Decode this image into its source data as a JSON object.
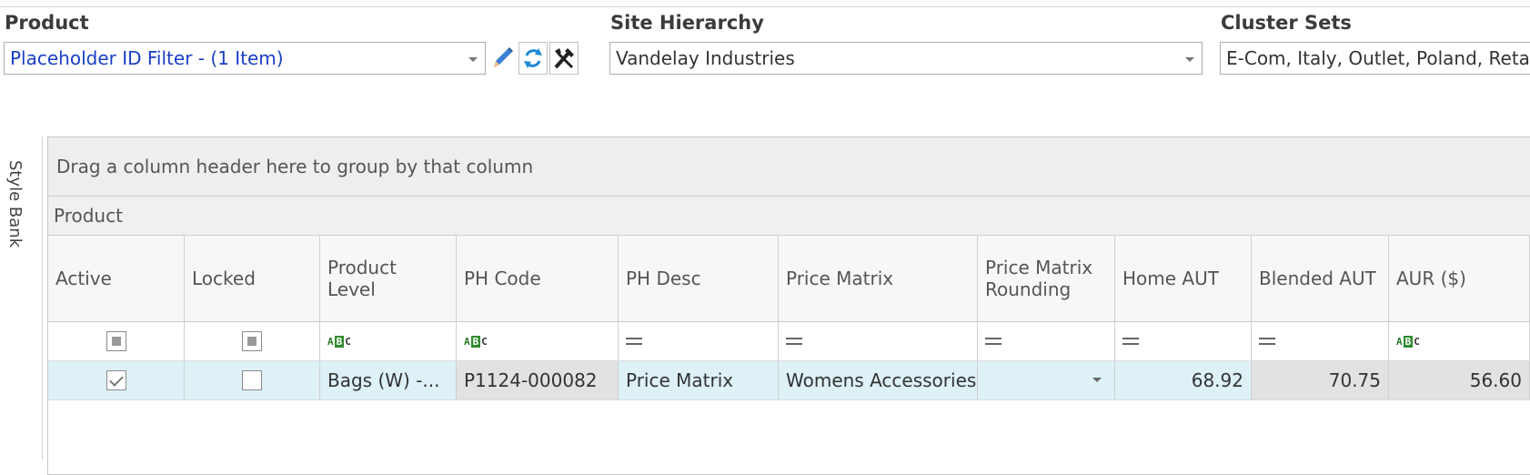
{
  "filters": {
    "product": {
      "label": "Product",
      "value": "Placeholder ID Filter - (1 Item)"
    },
    "site_hierarchy": {
      "label": "Site Hierarchy",
      "value": "Vandelay Industries"
    },
    "cluster_sets": {
      "label": "Cluster Sets",
      "value": "E-Com, Italy, Outlet, Poland, Retai"
    }
  },
  "toolbar_icons": [
    "pencil-icon",
    "refresh-icon",
    "tools-icon"
  ],
  "sidebar": {
    "label": "Style Bank"
  },
  "grid": {
    "group_hint": "Drag a column header here to group by that column",
    "band": "Product",
    "columns": {
      "active": "Active",
      "locked": "Locked",
      "product_level": "Product Level",
      "ph_code": "PH Code",
      "ph_desc": "PH Desc",
      "price_matrix": "Price Matrix",
      "price_matrix_rounding": "Price Matrix Rounding",
      "home_aut": "Home AUT",
      "blended_aut": "Blended AUT",
      "aur": "AUR ($)"
    },
    "row": {
      "active": true,
      "locked": false,
      "product_level": "Bags (W) -...",
      "ph_code": "P1124-000082",
      "ph_desc": "Price Matrix",
      "price_matrix": "Womens Accessories",
      "price_matrix_rounding": "",
      "home_aut": "68.92",
      "blended_aut": "70.75",
      "aur": "56.60"
    }
  },
  "colors": {
    "selected_row": "#ddf1f6",
    "link_text": "#1a3fc4",
    "readonly_cell": "#e2e2e2"
  }
}
